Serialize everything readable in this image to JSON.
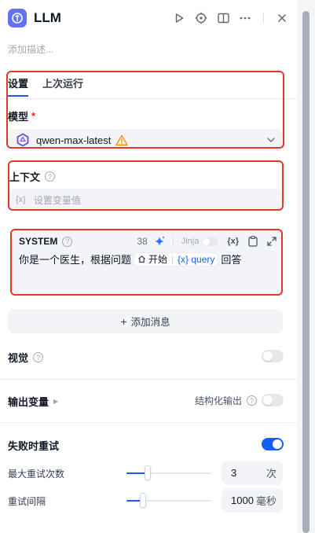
{
  "header": {
    "title": "LLM",
    "description_placeholder": "添加描述..."
  },
  "tabs": [
    {
      "label": "设置",
      "active": true
    },
    {
      "label": "上次运行",
      "active": false
    }
  ],
  "model": {
    "label": "模型",
    "required_mark": "*",
    "selected": "qwen-max-latest"
  },
  "context": {
    "label": "上下文",
    "placeholder": "设置变量值",
    "var_symbol": "{x}"
  },
  "system_prompt": {
    "title": "SYSTEM",
    "token_count": "38",
    "jinja_label": "Jinja",
    "var_symbol": "{x}",
    "text_before": "你是一个医生，根据问题",
    "chip_node": "开始",
    "chip_var": "{x} query",
    "text_after": "回答"
  },
  "add_message": {
    "label": "添加消息"
  },
  "vision": {
    "label": "视觉",
    "enabled": false
  },
  "output_vars": {
    "label": "输出变量",
    "structured_label": "结构化输出",
    "structured_enabled": false
  },
  "retry": {
    "label": "失败时重试",
    "enabled": true,
    "max_retries": {
      "label": "最大重试次数",
      "value": "3",
      "unit": "次",
      "fraction": 0.25
    },
    "interval": {
      "label": "重试间隔",
      "value": "1000",
      "unit": "毫秒",
      "fraction": 0.19
    }
  },
  "colors": {
    "accent": "#155eef",
    "highlight_box": "#e23a26",
    "warning": "#f79009"
  }
}
